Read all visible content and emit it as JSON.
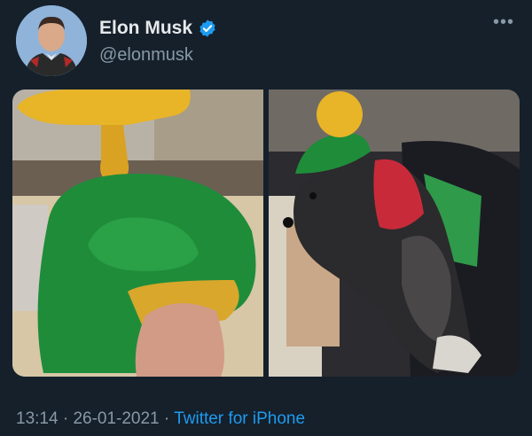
{
  "tweet": {
    "author": {
      "display_name": "Elon Musk",
      "handle": "@elonmusk",
      "verified": true,
      "verified_icon": "verified-badge-icon"
    },
    "more_icon": "more-options-icon",
    "media": [
      {
        "description_icon": "photo",
        "subject": "green-crochet-hat"
      },
      {
        "description_icon": "photo",
        "subject": "dog-wearing-hat"
      }
    ],
    "time": "13:14",
    "separator": "·",
    "date": "26-01-2021",
    "source": "Twitter for iPhone"
  },
  "colors": {
    "background": "#15202b",
    "primary_text": "#e7e9ea",
    "secondary_text": "#8899a6",
    "link": "#1d9bf0",
    "verified": "#1d9bf0"
  }
}
